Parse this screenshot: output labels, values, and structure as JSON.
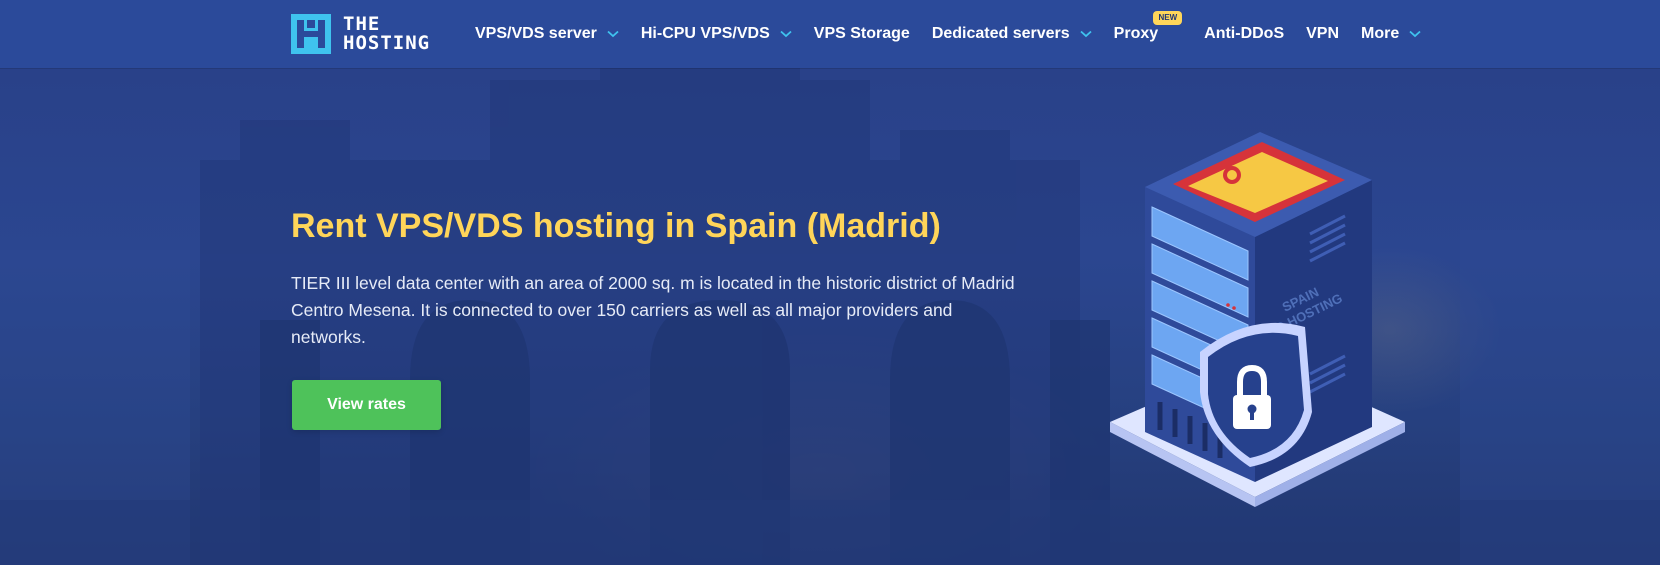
{
  "header": {
    "logo": {
      "line1": "THE",
      "line2": "HOSTING"
    },
    "nav": [
      {
        "label": "VPS/VDS server",
        "dropdown": true
      },
      {
        "label": "Hi-CPU VPS/VDS",
        "dropdown": true
      },
      {
        "label": "VPS Storage",
        "dropdown": false
      },
      {
        "label": "Dedicated servers",
        "dropdown": true
      },
      {
        "label": "Proxy",
        "dropdown": false,
        "badge": "NEW"
      },
      {
        "label": "Anti-DDoS",
        "dropdown": false
      },
      {
        "label": "VPN",
        "dropdown": false
      },
      {
        "label": "More",
        "dropdown": true
      }
    ]
  },
  "hero": {
    "title": "Rent VPS/VDS hosting in Spain (Madrid)",
    "description": "TIER III level data center with an area of 2000 sq. m is located in the historic district of Madrid Centro Mesena. It is connected to over 150 carriers as well as all major providers and networks.",
    "cta_label": "View rates",
    "illustration": {
      "label_line1": "SPAIN",
      "label_line2": "PQ.HOSTING"
    }
  },
  "colors": {
    "navbar": "#2b4a9a",
    "hero": "#2a4389",
    "title": "#ffd559",
    "cta": "#4ec25a",
    "logo_accent": "#3fc3ee",
    "chevron": "#3fc3ee"
  },
  "icons": [
    "logo-mark-icon",
    "chevron-down-icon",
    "lock-icon",
    "spain-flag-icon"
  ]
}
